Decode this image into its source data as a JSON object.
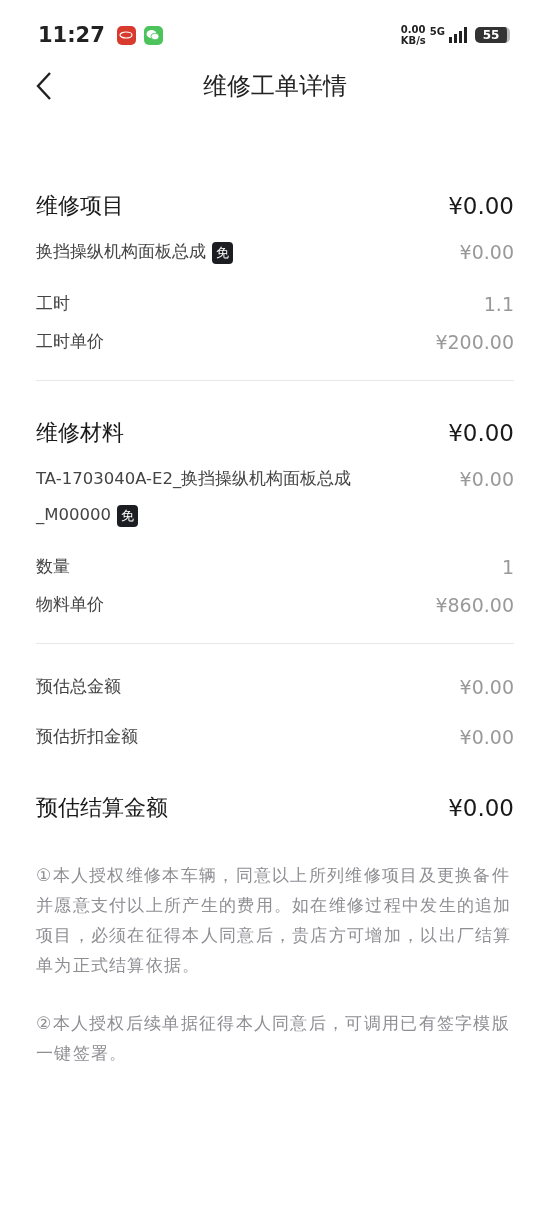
{
  "status_bar": {
    "time": "11:27",
    "network_speed": "0.00",
    "network_unit": "KB/s",
    "network_type": "5G",
    "battery": "55"
  },
  "header": {
    "title": "维修工单详情"
  },
  "sections": [
    {
      "title": "维修项目",
      "total": "¥0.00",
      "items": [
        {
          "name_lines": [
            "换挡操纵机构面板总成"
          ],
          "badge": "免",
          "value": "¥0.00"
        }
      ],
      "details": [
        {
          "label": "工时",
          "value": "1.1"
        },
        {
          "label": "工时单价",
          "value": "¥200.00"
        }
      ]
    },
    {
      "title": "维修材料",
      "total": "¥0.00",
      "items": [
        {
          "name_lines": [
            "TA-1703040A-E2_换挡操纵机构面板总成",
            "_M00000"
          ],
          "badge": "免",
          "value": "¥0.00"
        }
      ],
      "details": [
        {
          "label": "数量",
          "value": "1"
        },
        {
          "label": "物料单价",
          "value": "¥860.00"
        }
      ]
    }
  ],
  "summary": [
    {
      "label": "预估总金额",
      "value": "¥0.00"
    },
    {
      "label": "预估折扣金额",
      "value": "¥0.00"
    }
  ],
  "final": {
    "label": "预估结算金额",
    "value": "¥0.00"
  },
  "notes": [
    "①本人授权维修本车辆，同意以上所列维修项目及更换备件并愿意支付以上所产生的费用。如在维修过程中发生的追加项目，必须在征得本人同意后，贵店方可增加，以出厂结算单为正式结算依据。",
    "②本人授权后续单据征得本人同意后，可调用已有签字模版一键签署。"
  ]
}
